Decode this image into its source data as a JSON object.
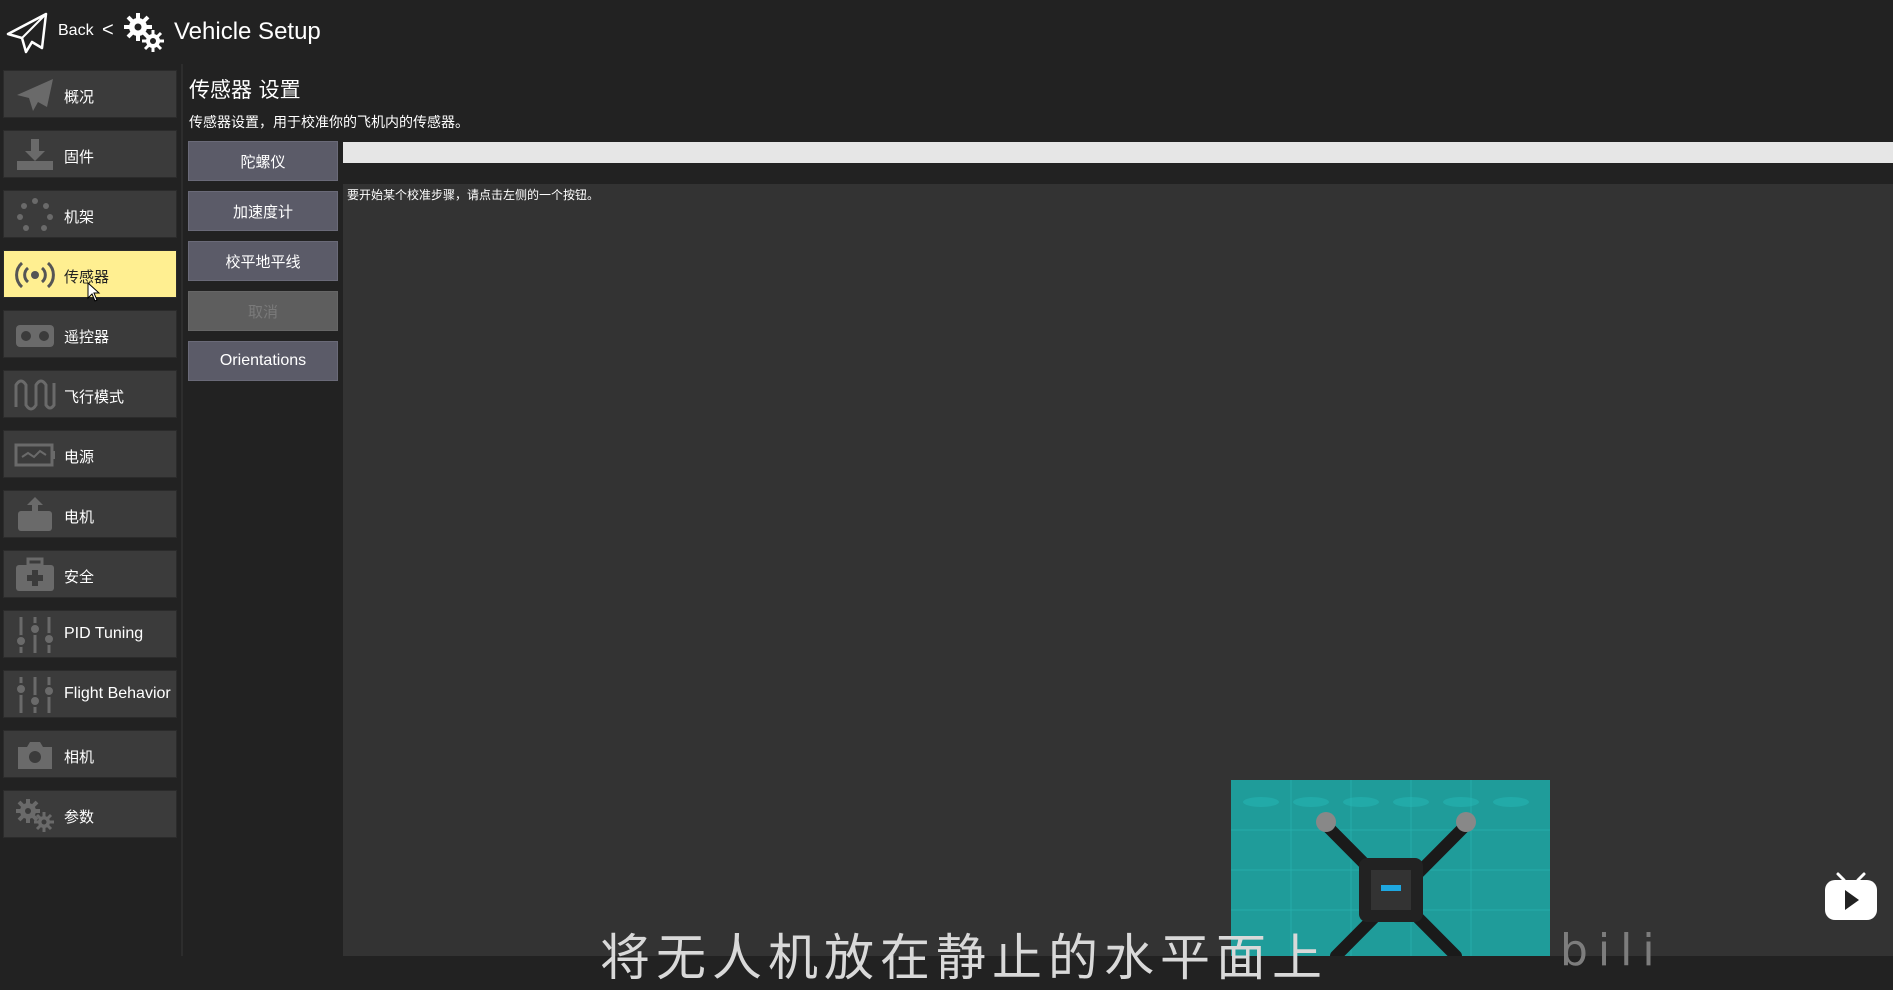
{
  "header": {
    "back_label": "Back",
    "chevron": "<",
    "title": "Vehicle Setup",
    "icons": [
      "paper-plane-icon",
      "gears-icon"
    ]
  },
  "sidebar": {
    "items": [
      {
        "label": "概况",
        "icon": "paper-plane-icon",
        "active": false
      },
      {
        "label": "固件",
        "icon": "download-icon",
        "active": false
      },
      {
        "label": "机架",
        "icon": "airframe-icon",
        "active": false
      },
      {
        "label": "传感器",
        "icon": "sensor-waves-icon",
        "active": true
      },
      {
        "label": "遥控器",
        "icon": "radio-controller-icon",
        "active": false
      },
      {
        "label": "飞行模式",
        "icon": "flight-mode-wave-icon",
        "active": false
      },
      {
        "label": "电源",
        "icon": "power-monitor-icon",
        "active": false
      },
      {
        "label": "电机",
        "icon": "motor-icon",
        "active": false
      },
      {
        "label": "安全",
        "icon": "safety-kit-icon",
        "active": false
      },
      {
        "label": "PID Tuning",
        "icon": "sliders-icon",
        "active": false
      },
      {
        "label": "Flight Behavior",
        "icon": "sliders-icon",
        "active": false
      },
      {
        "label": "相机",
        "icon": "camera-icon",
        "active": false
      },
      {
        "label": "参数",
        "icon": "gears-icon",
        "active": false
      }
    ]
  },
  "main": {
    "title": "传感器 设置",
    "description": "传感器设置，用于校准你的飞机内的传感器。",
    "buttons": [
      {
        "label": "陀螺仪",
        "enabled": true
      },
      {
        "label": "加速度计",
        "enabled": true
      },
      {
        "label": "校平地平线",
        "enabled": true
      },
      {
        "label": "取消",
        "enabled": false
      },
      {
        "label": "Orientations",
        "enabled": true
      }
    ],
    "progress": 0,
    "status_text": "要开始某个校准步骤，请点击左侧的一个按钮。"
  },
  "overlay": {
    "subtitle": "将无人机放在静止的水平面上",
    "subtitle_tail": "bili",
    "play_icon": "video-play-icon"
  },
  "colors": {
    "background": "#222222",
    "nav_button": "#3b3b3b",
    "nav_active": "#ffef91",
    "calibrate_button": "#5b5b68",
    "panel": "#333333"
  }
}
